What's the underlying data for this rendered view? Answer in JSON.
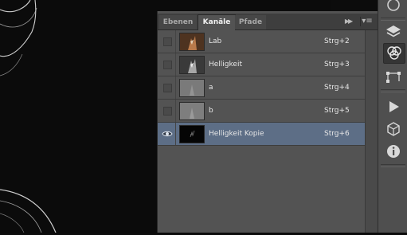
{
  "tabs": [
    {
      "label": "Ebenen"
    },
    {
      "label": "Kanäle"
    },
    {
      "label": "Pfade"
    }
  ],
  "channels": [
    {
      "name": "Lab",
      "shortcut": "Strg+2",
      "visible": false,
      "selected": false,
      "thumbnail": "color"
    },
    {
      "name": "Helligkeit",
      "shortcut": "Strg+3",
      "visible": false,
      "selected": false,
      "thumbnail": "grayscale"
    },
    {
      "name": "a",
      "shortcut": "Strg+4",
      "visible": false,
      "selected": false,
      "thumbnail": "grayscale-flat"
    },
    {
      "name": "b",
      "shortcut": "Strg+5",
      "visible": false,
      "selected": false,
      "thumbnail": "grayscale-flat"
    },
    {
      "name": "Helligkeit Kopie",
      "shortcut": "Strg+6",
      "visible": true,
      "selected": true,
      "thumbnail": "dark"
    }
  ],
  "dock_icons": [
    "history-icon",
    "layers-icon",
    "channels-icon",
    "paths-icon",
    "play-icon",
    "3d-icon",
    "info-icon"
  ],
  "colors": {
    "selected_row": "#5d6e86",
    "panel_bg": "#535353",
    "canvas_bg": "#0b0b0b"
  }
}
